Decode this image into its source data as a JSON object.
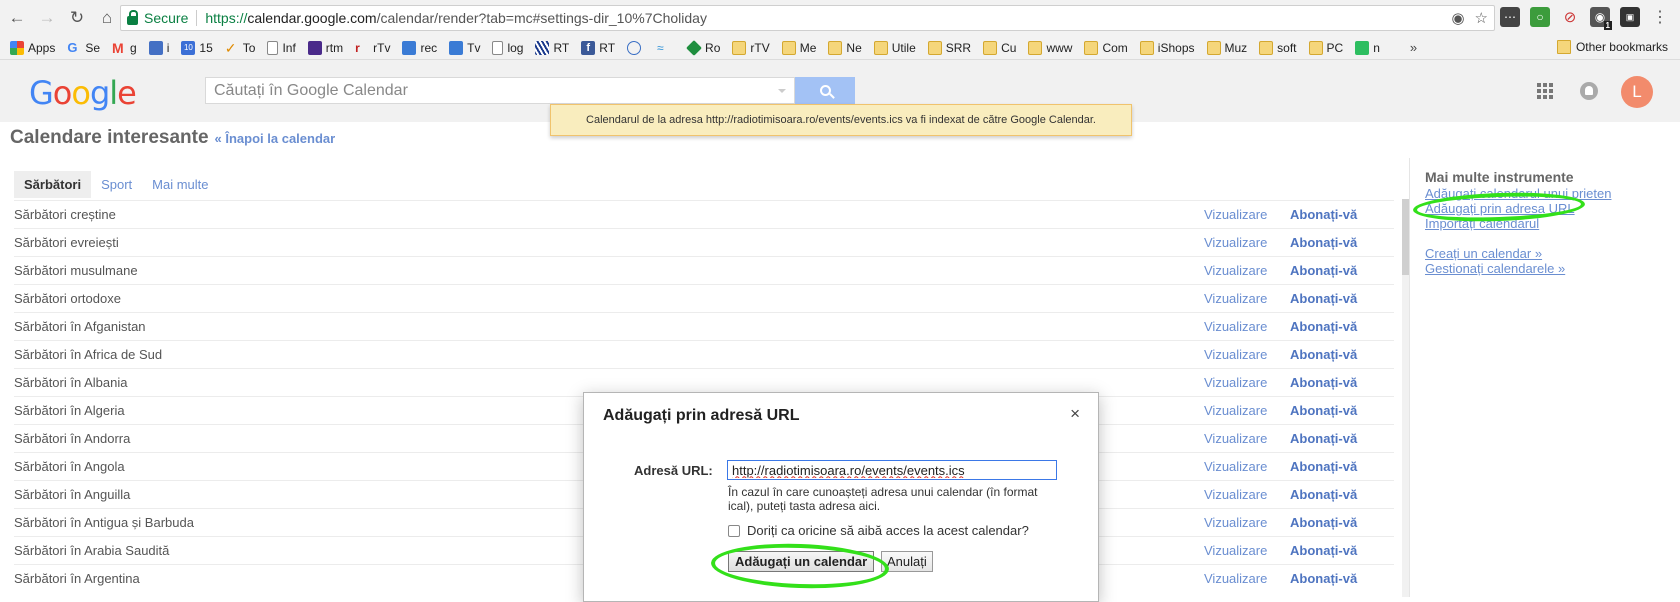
{
  "browser": {
    "secure_label": "Secure",
    "url_scheme": "https://",
    "url_host": "calendar.google.com",
    "url_path": "/calendar/render?tab=mc#settings-dir_10%7Choliday"
  },
  "bookmarks": {
    "items": [
      "Apps",
      "Se",
      "g",
      "i",
      "15",
      "To",
      "Inf",
      "rtm",
      "rTv",
      "rec",
      "Tv",
      "log",
      "RT",
      "RT",
      "Ro",
      "rTV",
      "Me",
      "Ne",
      "Utile",
      "SRR",
      "Cu",
      "www",
      "Com",
      "iShops",
      "Muz",
      "soft",
      "PC",
      "n"
    ],
    "more": "»",
    "other": "Other bookmarks",
    "badge": "1"
  },
  "header": {
    "logo": "Google",
    "search_placeholder": "Căutați în Google Calendar",
    "avatar_letter": "L"
  },
  "toast": "Calendarul de la adresa http://radiotimisoara.ro/events/events.ics va fi indexat de către Google Calendar.",
  "page": {
    "title": "Calendare interesante",
    "back": "« Înapoi la calendar"
  },
  "tabs": [
    "Sărbători",
    "Sport",
    "Mai multe"
  ],
  "row_actions": {
    "view": "Vizualizare",
    "subscribe": "Abonați-vă"
  },
  "calendars": [
    "Sărbători creștine",
    "Sărbători evreiești",
    "Sărbători musulmane",
    "Sărbători ortodoxe",
    "Sărbători în Afganistan",
    "Sărbători în Africa de Sud",
    "Sărbători în Albania",
    "Sărbători în Algeria",
    "Sărbători în Andorra",
    "Sărbători în Angola",
    "Sărbători în Anguilla",
    "Sărbători în Antigua și Barbuda",
    "Sărbători în Arabia Saudită",
    "Sărbători în Argentina"
  ],
  "tools": {
    "heading": "Mai multe instrumente",
    "links": [
      "Adăugați calendarul unui prieten",
      "Adăugați prin adresa URL",
      "Importați calendarul"
    ],
    "links2": [
      "Creați un calendar »",
      "Gestionați calendarele »"
    ]
  },
  "dialog": {
    "title": "Adăugați prin adresă URL",
    "close": "×",
    "url_label": "Adresă URL:",
    "url_value": "http://radiotimisoara.ro/events/events.ics",
    "help": "În cazul în care cunoașteți adresa unui calendar (în format ical), puteți tasta adresa aici.",
    "public_label": "Doriți ca oricine să aibă acces la acest calendar?",
    "add_button": "Adăugați un calendar",
    "cancel_button": "Anulați"
  },
  "colors": {
    "link": "#6a8ed1",
    "highlight": "#33e01a",
    "secure": "#0b8043"
  }
}
